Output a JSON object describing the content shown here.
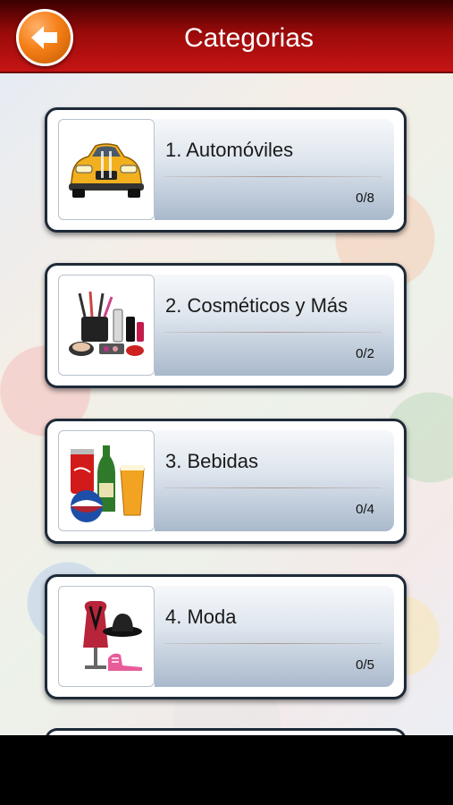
{
  "header": {
    "title": "Categorias",
    "back_icon": "arrow-left-icon",
    "accent_color": "#c61414"
  },
  "categories": [
    {
      "label": "1. Automóviles",
      "progress": "0/8",
      "icon": "car-icon"
    },
    {
      "label": "2. Cosméticos y Más",
      "progress": "0/2",
      "icon": "cosmetics-icon"
    },
    {
      "label": "3. Bebidas",
      "progress": "0/4",
      "icon": "drinks-icon"
    },
    {
      "label": "4. Moda",
      "progress": "0/5",
      "icon": "fashion-icon"
    }
  ]
}
